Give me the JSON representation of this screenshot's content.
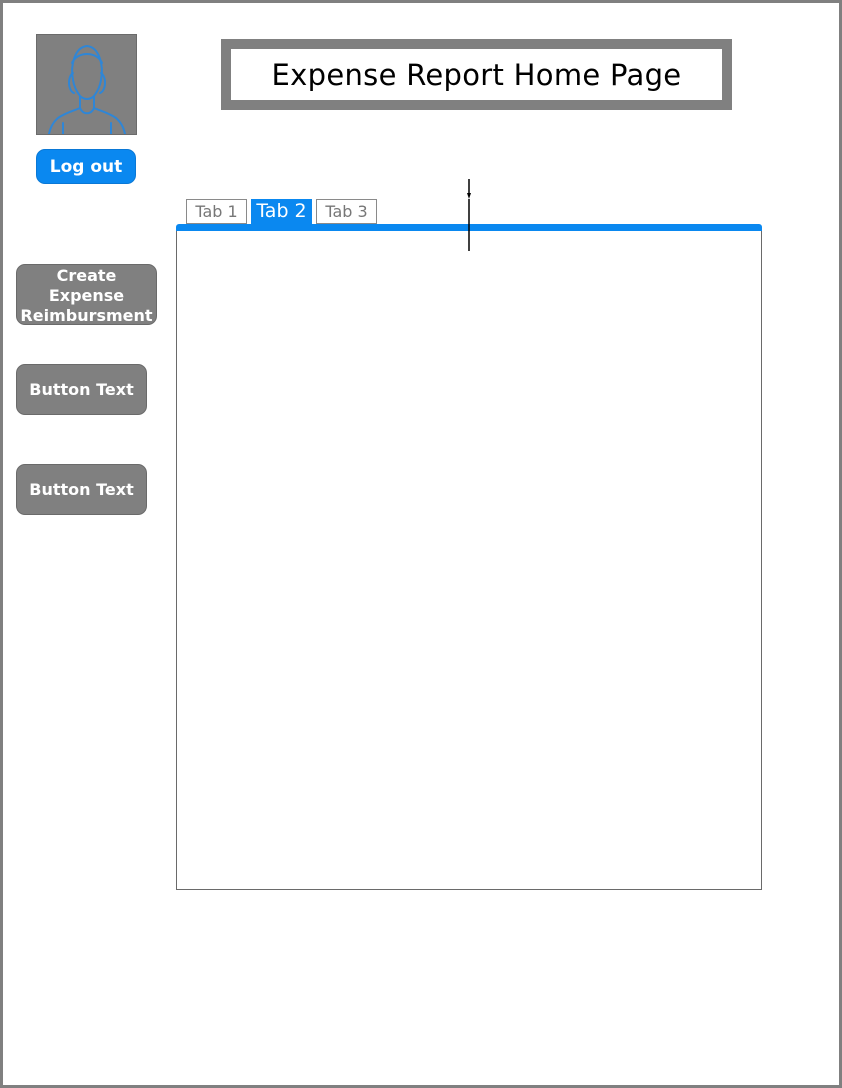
{
  "header": {
    "title": "Expense Report Home Page"
  },
  "user": {
    "avatar_icon": "user-avatar-icon",
    "logout_label": "Log out"
  },
  "sidebar": {
    "buttons": [
      {
        "label_lines": [
          "Create",
          "Expense",
          "Reimbursment"
        ]
      },
      {
        "label": "Button Text"
      },
      {
        "label": "Button Text"
      }
    ]
  },
  "tabs": {
    "items": [
      {
        "label": "Tab 1",
        "active": false
      },
      {
        "label": "Tab 2",
        "active": true
      },
      {
        "label": "Tab 3",
        "active": false
      }
    ]
  },
  "colors": {
    "accent": "#0a88f0",
    "neutral": "#808080",
    "text": "#000000"
  }
}
